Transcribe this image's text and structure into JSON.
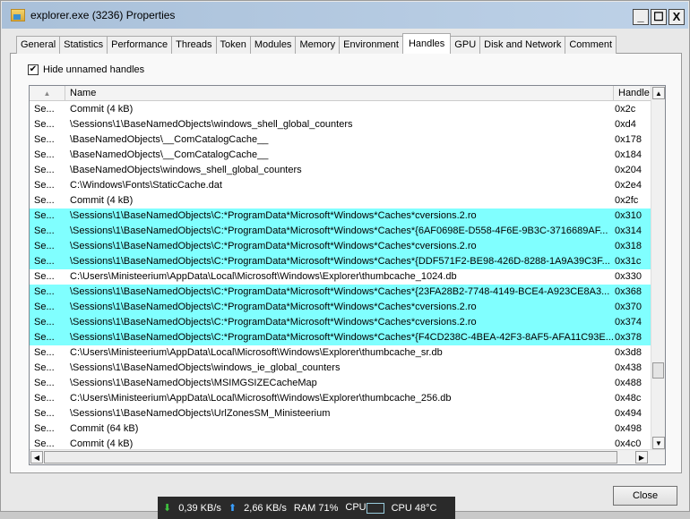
{
  "window": {
    "title": "explorer.exe (3236) Properties",
    "min": "_",
    "max": "☐",
    "close": "X"
  },
  "tabs": [
    "General",
    "Statistics",
    "Performance",
    "Threads",
    "Token",
    "Modules",
    "Memory",
    "Environment",
    "Handles",
    "GPU",
    "Disk and Network",
    "Comment"
  ],
  "active_tab": "Handles",
  "hide_unnamed": {
    "label": "Hide unnamed handles",
    "checked": true,
    "mark": "✔"
  },
  "columns": {
    "sort": "▲",
    "name": "Name",
    "handle": "Handle"
  },
  "rows": [
    {
      "type": "Se...",
      "name": "Commit (4 kB)",
      "handle": "0x2c",
      "hl": false
    },
    {
      "type": "Se...",
      "name": "\\Sessions\\1\\BaseNamedObjects\\windows_shell_global_counters",
      "handle": "0xd4",
      "hl": false
    },
    {
      "type": "Se...",
      "name": "\\BaseNamedObjects\\__ComCatalogCache__",
      "handle": "0x178",
      "hl": false
    },
    {
      "type": "Se...",
      "name": "\\BaseNamedObjects\\__ComCatalogCache__",
      "handle": "0x184",
      "hl": false
    },
    {
      "type": "Se...",
      "name": "\\BaseNamedObjects\\windows_shell_global_counters",
      "handle": "0x204",
      "hl": false
    },
    {
      "type": "Se...",
      "name": "C:\\Windows\\Fonts\\StaticCache.dat",
      "handle": "0x2e4",
      "hl": false
    },
    {
      "type": "Se...",
      "name": "Commit (4 kB)",
      "handle": "0x2fc",
      "hl": false
    },
    {
      "type": "Se...",
      "name": "\\Sessions\\1\\BaseNamedObjects\\C:*ProgramData*Microsoft*Windows*Caches*cversions.2.ro",
      "handle": "0x310",
      "hl": true
    },
    {
      "type": "Se...",
      "name": "\\Sessions\\1\\BaseNamedObjects\\C:*ProgramData*Microsoft*Windows*Caches*{6AF0698E-D558-4F6E-9B3C-3716689AF...",
      "handle": "0x314",
      "hl": true
    },
    {
      "type": "Se...",
      "name": "\\Sessions\\1\\BaseNamedObjects\\C:*ProgramData*Microsoft*Windows*Caches*cversions.2.ro",
      "handle": "0x318",
      "hl": true
    },
    {
      "type": "Se...",
      "name": "\\Sessions\\1\\BaseNamedObjects\\C:*ProgramData*Microsoft*Windows*Caches*{DDF571F2-BE98-426D-8288-1A9A39C3F...",
      "handle": "0x31c",
      "hl": true
    },
    {
      "type": "Se...",
      "name": "C:\\Users\\Ministeerium\\AppData\\Local\\Microsoft\\Windows\\Explorer\\thumbcache_1024.db",
      "handle": "0x330",
      "hl": false
    },
    {
      "type": "Se...",
      "name": "\\Sessions\\1\\BaseNamedObjects\\C:*ProgramData*Microsoft*Windows*Caches*{23FA28B2-7748-4149-BCE4-A923CE8A3...",
      "handle": "0x368",
      "hl": true
    },
    {
      "type": "Se...",
      "name": "\\Sessions\\1\\BaseNamedObjects\\C:*ProgramData*Microsoft*Windows*Caches*cversions.2.ro",
      "handle": "0x370",
      "hl": true
    },
    {
      "type": "Se...",
      "name": "\\Sessions\\1\\BaseNamedObjects\\C:*ProgramData*Microsoft*Windows*Caches*cversions.2.ro",
      "handle": "0x374",
      "hl": true
    },
    {
      "type": "Se...",
      "name": "\\Sessions\\1\\BaseNamedObjects\\C:*ProgramData*Microsoft*Windows*Caches*{F4CD238C-4BEA-42F3-8AF5-AFA11C93E...",
      "handle": "0x378",
      "hl": true
    },
    {
      "type": "Se...",
      "name": "C:\\Users\\Ministeerium\\AppData\\Local\\Microsoft\\Windows\\Explorer\\thumbcache_sr.db",
      "handle": "0x3d8",
      "hl": false
    },
    {
      "type": "Se...",
      "name": "\\Sessions\\1\\BaseNamedObjects\\windows_ie_global_counters",
      "handle": "0x438",
      "hl": false
    },
    {
      "type": "Se...",
      "name": "\\Sessions\\1\\BaseNamedObjects\\MSIMGSIZECacheMap",
      "handle": "0x488",
      "hl": false
    },
    {
      "type": "Se...",
      "name": "C:\\Users\\Ministeerium\\AppData\\Local\\Microsoft\\Windows\\Explorer\\thumbcache_256.db",
      "handle": "0x48c",
      "hl": false
    },
    {
      "type": "Se...",
      "name": "\\Sessions\\1\\BaseNamedObjects\\UrlZonesSM_Ministeerium",
      "handle": "0x494",
      "hl": false
    },
    {
      "type": "Se...",
      "name": "Commit (64 kB)",
      "handle": "0x498",
      "hl": false
    },
    {
      "type": "Se...",
      "name": "Commit (4 kB)",
      "handle": "0x4c0",
      "hl": false
    }
  ],
  "close_button": "Close",
  "taskbar": {
    "down_icon": "⬇",
    "down": "0,39 KB/s",
    "up_icon": "⬆",
    "up": "2,66 KB/s",
    "ram": "RAM 71%",
    "cpu": "CPU",
    "cpu_temp": "CPU 48°C"
  },
  "colors": {
    "highlight": "#80ffff"
  }
}
